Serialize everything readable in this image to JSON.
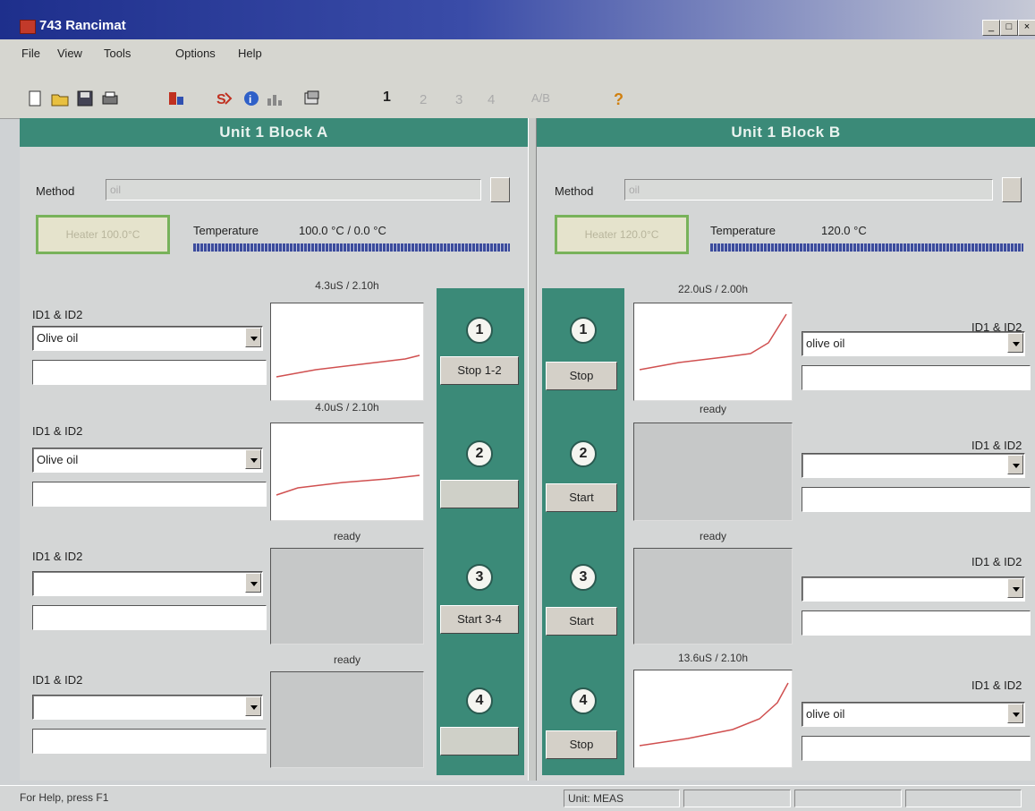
{
  "window": {
    "title": "743 Rancimat"
  },
  "menu": [
    "File",
    "View",
    "Tools",
    "Options",
    "Help"
  ],
  "toolbar": {
    "icons": [
      "new-icon",
      "open-icon",
      "save-icon",
      "print-icon",
      "method-icon",
      "start-icon",
      "info-icon",
      "chart-icon",
      "settings-icon",
      "one-icon",
      "two-icon",
      "three-icon",
      "four-icon",
      "text-icon",
      "help-icon"
    ],
    "text_1": "1",
    "text_ab": "A/B"
  },
  "blockA": {
    "header": "Unit 1   Block A",
    "method_label": "Method",
    "method_value": "oil",
    "heater": "Heater 100.0°C",
    "temperature_label": "Temperature",
    "temperature_value": "100.0 °C / 0.0 °C",
    "rows": [
      {
        "id_label": "ID1 & ID2",
        "sample": "Olive oil",
        "graph_label": "4.3uS / 2.10h",
        "has_graph": true
      },
      {
        "id_label": "ID1 & ID2",
        "sample": "Olive oil",
        "graph_label": "4.0uS / 2.10h",
        "has_graph": true
      },
      {
        "id_label": "ID1 & ID2",
        "sample": "",
        "graph_label": "ready",
        "has_graph": false
      },
      {
        "id_label": "ID1 & ID2",
        "sample": "",
        "graph_label": "ready",
        "has_graph": false
      }
    ],
    "buttons": [
      {
        "num": "1",
        "label": "Stop 1-2",
        "disabled": false
      },
      {
        "num": "2",
        "label": "",
        "disabled": true
      },
      {
        "num": "3",
        "label": "Start 3-4",
        "disabled": false
      },
      {
        "num": "4",
        "label": "",
        "disabled": true
      }
    ]
  },
  "blockB": {
    "header": "Unit 1   Block B",
    "method_label": "Method",
    "method_value": "oil",
    "heater": "Heater 120.0°C",
    "temperature_label": "Temperature",
    "temperature_value": "120.0 °C",
    "rows": [
      {
        "id_label": "ID1 & ID2",
        "sample": "olive oil",
        "graph_label": "22.0uS / 2.00h",
        "has_graph": true
      },
      {
        "id_label": "ID1 & ID2",
        "sample": "",
        "graph_label": "ready",
        "has_graph": false
      },
      {
        "id_label": "ID1 & ID2",
        "sample": "",
        "graph_label": "ready",
        "has_graph": false
      },
      {
        "id_label": "ID1 & ID2",
        "sample": "olive oil",
        "graph_label": "13.6uS / 2.10h",
        "has_graph": true
      }
    ],
    "buttons": [
      {
        "num": "1",
        "label": "Stop"
      },
      {
        "num": "2",
        "label": "Start"
      },
      {
        "num": "3",
        "label": "Start"
      },
      {
        "num": "4",
        "label": "Stop"
      }
    ]
  },
  "status": {
    "help": "For Help, press F1",
    "unit": "Unit: MEAS"
  },
  "colors": {
    "teal": "#3b8a78",
    "curve": "#d05050",
    "titlebar": "#1e2f8c"
  }
}
